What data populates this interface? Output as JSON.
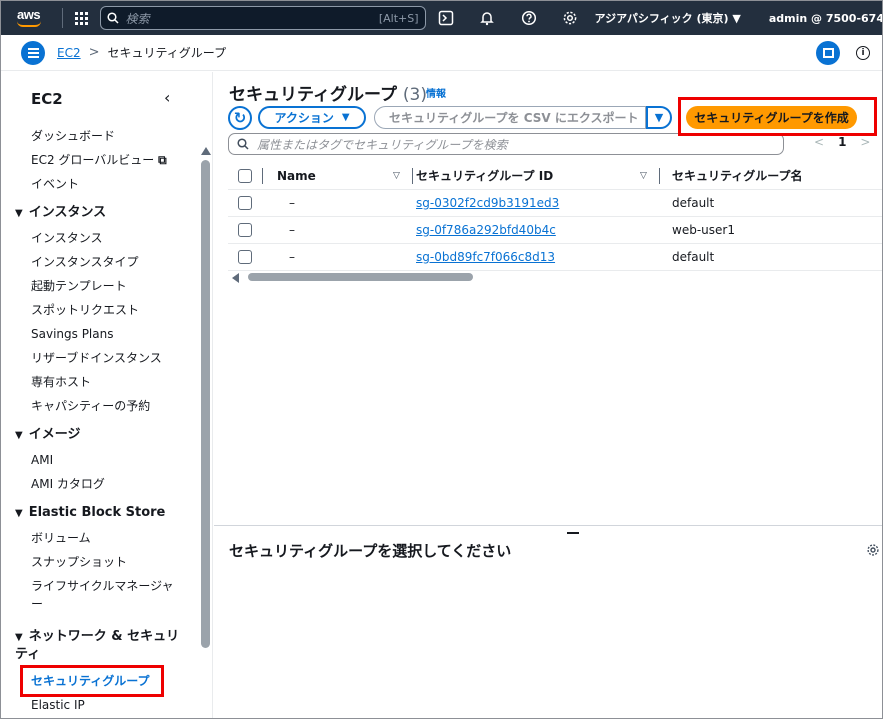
{
  "topnav": {
    "logo": "aws",
    "search_placeholder": "検索",
    "search_shortcut": "[Alt+S]",
    "region": "アジアパシフィック (東京) ▼",
    "account": "admin @ 7500-674"
  },
  "breadcrumb": {
    "service": "EC2",
    "current": "セキュリティグループ"
  },
  "sidebar": {
    "title": "EC2",
    "top_items": [
      "ダッシュボード",
      "EC2 グローバルビュー",
      "イベント"
    ],
    "sections": [
      {
        "label": "インスタンス",
        "items": [
          "インスタンス",
          "インスタンスタイプ",
          "起動テンプレート",
          "スポットリクエスト",
          "Savings Plans",
          "リザーブドインスタンス",
          "専有ホスト",
          "キャパシティーの予約"
        ]
      },
      {
        "label": "イメージ",
        "items": [
          "AMI",
          "AMI カタログ"
        ]
      },
      {
        "label": "Elastic Block Store",
        "items": [
          "ボリューム",
          "スナップショット",
          "ライフサイクルマネージャー"
        ]
      },
      {
        "label": "ネットワーク & セキュリティ",
        "items": [
          "セキュリティグループ",
          "Elastic IP"
        ]
      }
    ]
  },
  "main": {
    "heading": "セキュリティグループ",
    "count": "(3)",
    "info_link": "情報",
    "actions_label": "アクション",
    "export_label": "セキュリティグループを CSV にエクスポート",
    "create_label": "セキュリティグループを作成",
    "filter_placeholder": "属性またはタグでセキュリティグループを検索",
    "pager": {
      "prev": "<",
      "page": "1",
      "next": ">"
    },
    "table": {
      "columns": [
        "Name",
        "セキュリティグループ ID",
        "セキュリティグループ名"
      ],
      "rows": [
        {
          "name": "–",
          "id": "sg-0302f2cd9b3191ed3",
          "group_name": "default"
        },
        {
          "name": "–",
          "id": "sg-0f786a292bfd40b4c",
          "group_name": "web-user1"
        },
        {
          "name": "–",
          "id": "sg-0bd89fc7f066c8d13",
          "group_name": "default"
        }
      ]
    },
    "bottom_title": "セキュリティグループを選択してください"
  },
  "colors": {
    "nav_bg": "#232f3e",
    "accent": "#0972d3",
    "primary_button": "#ff9900",
    "highlight": "#ee0000"
  }
}
